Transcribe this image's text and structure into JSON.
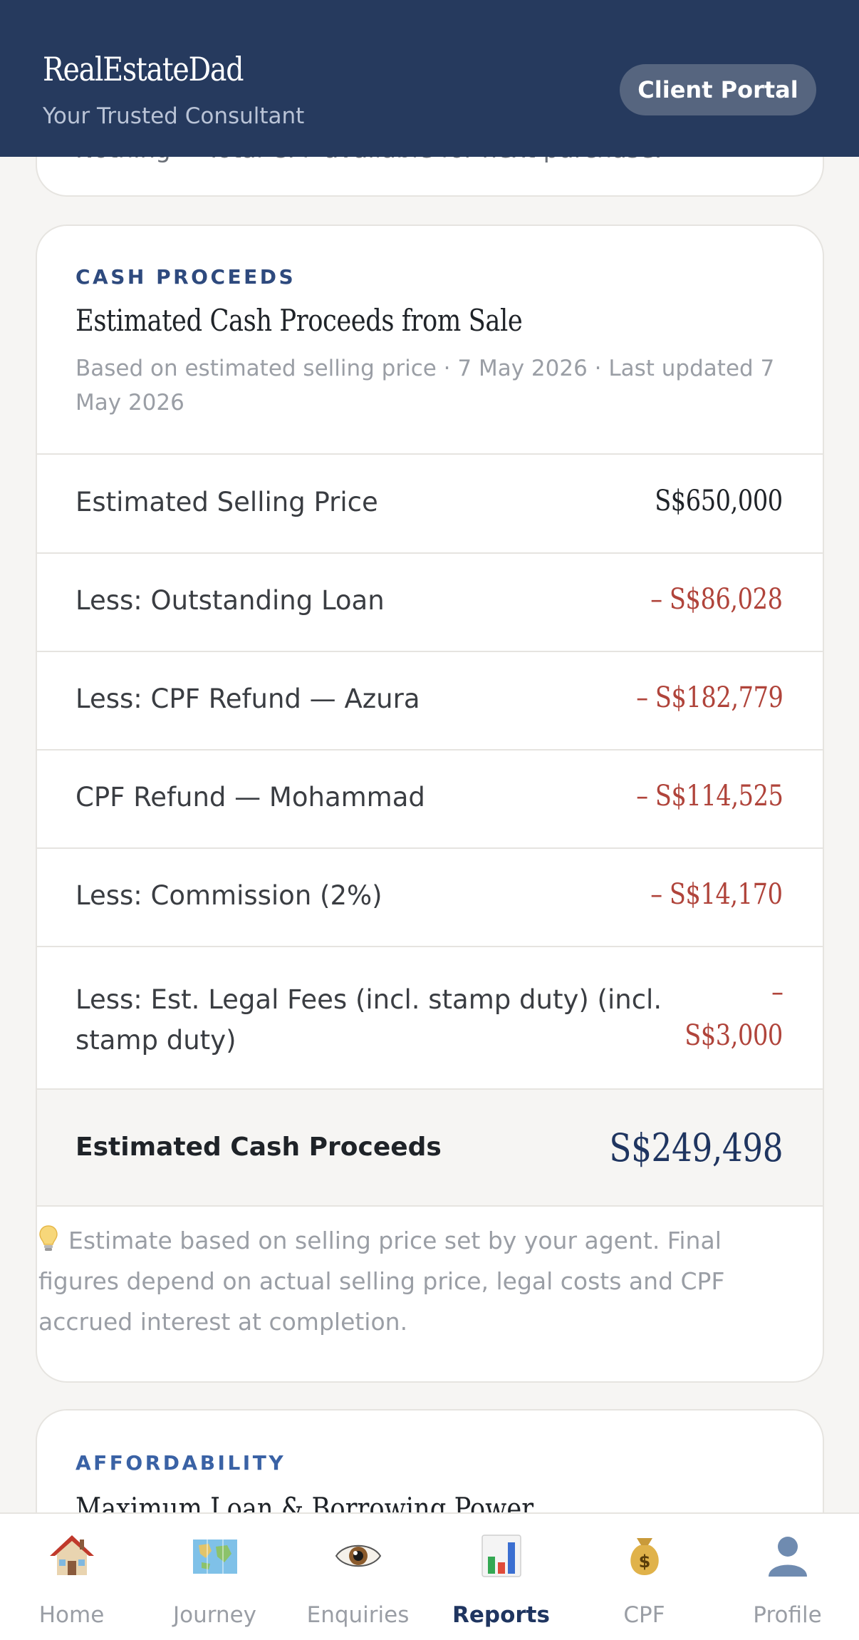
{
  "header": {
    "brand": "RealEstateDad",
    "tagline": "Your Trusted Consultant",
    "portal_button": "Client Portal"
  },
  "previous_card": {
    "text": "Nothing = Total CPF available for next purchase."
  },
  "cash_card": {
    "eyebrow": "CASH PROCEEDS",
    "title": "Estimated Cash Proceeds from Sale",
    "subtitle": "Based on estimated selling price · 7 May 2026 · Last updated 7 May 2026",
    "rows": [
      {
        "label": "Estimated Selling Price",
        "value": "S$650,000"
      },
      {
        "label": "Less: Outstanding Loan",
        "value": "– S$86,028"
      },
      {
        "label": "Less: CPF Refund — Azura",
        "value": "– S$182,779"
      },
      {
        "label": "CPF Refund — Mohammad",
        "value": "– S$114,525"
      },
      {
        "label": "Less: Commission (2%)",
        "value": "– S$14,170"
      },
      {
        "label": "Less: Est. Legal Fees (incl. stamp duty) (incl. stamp duty)",
        "value_prefix": "–",
        "value": "S$3,000"
      }
    ],
    "total": {
      "label": "Estimated Cash Proceeds",
      "value": "S$249,498"
    },
    "note": "Estimate based on selling price set by your agent. Final figures depend on actual selling price, legal costs and CPF accrued interest at completion."
  },
  "next_card": {
    "eyebrow": "AFFORDABILITY",
    "title": "Maximum Loan & Borrowing Power"
  },
  "nav": {
    "items": [
      {
        "label": "Home",
        "icon": "house-icon"
      },
      {
        "label": "Journey",
        "icon": "map-icon"
      },
      {
        "label": "Enquiries",
        "icon": "eye-icon"
      },
      {
        "label": "Reports",
        "icon": "bar-chart-icon"
      },
      {
        "label": "CPF",
        "icon": "money-bag-icon"
      },
      {
        "label": "Profile",
        "icon": "person-icon"
      }
    ],
    "active": "Reports"
  },
  "colors": {
    "header_bg": "#263a5e",
    "negative": "#b0443b",
    "accent": "#1f3560"
  }
}
